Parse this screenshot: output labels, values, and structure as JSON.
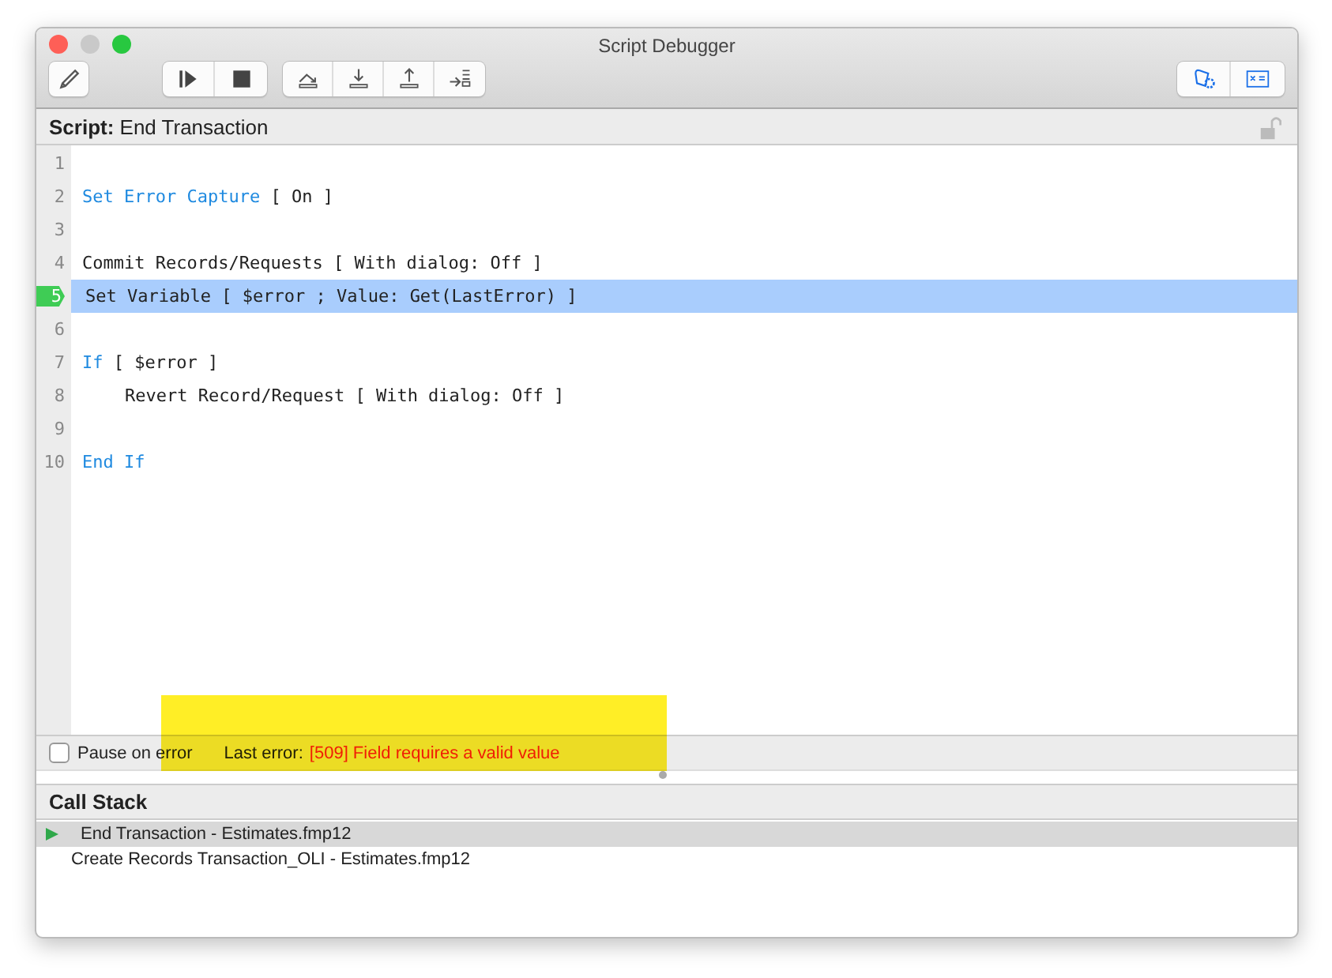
{
  "window": {
    "title": "Script Debugger"
  },
  "script": {
    "label": "Script:",
    "name": "End Transaction",
    "locked": false
  },
  "lines": [
    {
      "number": "1",
      "kind": "blank",
      "current": false
    },
    {
      "number": "2",
      "step": "Set Error Capture",
      "kind": "control",
      "params": "[ On ]",
      "current": false
    },
    {
      "number": "3",
      "kind": "blank",
      "current": false
    },
    {
      "number": "4",
      "step": "Commit Records/Requests",
      "kind": "action",
      "params": "[ With dialog: Off ]",
      "current": false
    },
    {
      "number": "5",
      "step": "Set Variable",
      "kind": "action",
      "params": "[ $error ; Value: Get(LastError) ]",
      "current": true
    },
    {
      "number": "6",
      "kind": "blank",
      "current": false
    },
    {
      "number": "7",
      "step": "If",
      "kind": "control",
      "params": "[ $error ]",
      "current": false,
      "children": [
        {
          "number": "8",
          "step": "Revert Record/Request",
          "kind": "action",
          "params": "[ With dialog: Off ]",
          "current": false
        }
      ]
    },
    {
      "number": "9",
      "kind": "blank",
      "current": false
    },
    {
      "number": "10",
      "step": "End If",
      "kind": "control",
      "current": false
    }
  ],
  "status": {
    "pause_label": "Pause on error",
    "pause_checked": false,
    "error_label": "Last error:",
    "error_text": "[509] Field requires a valid value"
  },
  "call_stack": {
    "title": "Call Stack",
    "items": [
      {
        "label": "End Transaction - Estimates.fmp12",
        "selected": true
      },
      {
        "label": "Create Records Transaction_OLI - Estimates.fmp12",
        "selected": false
      }
    ]
  }
}
